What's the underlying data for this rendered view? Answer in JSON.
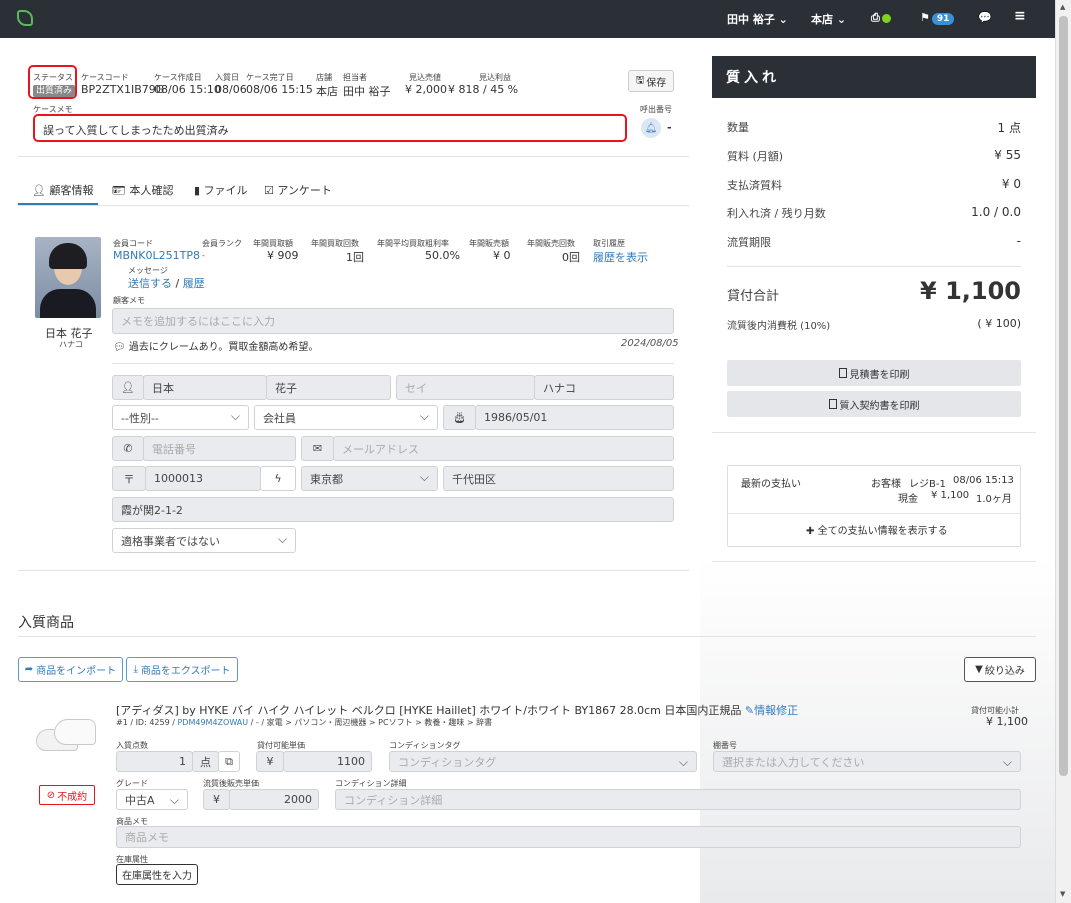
{
  "nav": {
    "user": "田中 裕子 ⌄",
    "store": "本店 ⌄",
    "badge": "91"
  },
  "case": {
    "status_label": "ステータス",
    "status": "出質済み",
    "code_label": "ケースコード",
    "code": "BP2ZTX1IB79G",
    "created_label": "ケース作成日",
    "created": "08/06 15:10",
    "in_label": "入質日",
    "in": "08/06",
    "done_label": "ケース完了日",
    "done": "08/06 15:15",
    "store_label": "店舗",
    "store": "本店",
    "staff_label": "担当者",
    "staff": "田中 裕子",
    "est_sales_label": "見込売値",
    "est_sales": "¥ 2,000",
    "est_profit_label": "見込利益",
    "est_profit": "¥ 818 / 45 %",
    "save": "保存",
    "memo_label": "ケースメモ",
    "memo": "誤って入質してしまったため出質済み",
    "call_label": "呼出番号",
    "call_value": "-"
  },
  "tabs": [
    "顧客情報",
    "本人確認",
    "ファイル",
    "アンケート"
  ],
  "customer": {
    "name": "日本 花子",
    "kana": "ハナコ",
    "code_label": "会員コード",
    "code": "MBNK0L251TP8",
    "rank_label": "会員ランク",
    "rank": "-",
    "buy_amount_label": "年間買取額",
    "buy_amount": "¥ 909",
    "buy_count_label": "年間買取回数",
    "buy_count": "1回",
    "margin_label": "年間平均買取粗利率",
    "margin": "50.0%",
    "sales_label": "年間販売額",
    "sales": "¥ 0",
    "sales_count_label": "年間販売回数",
    "sales_count": "0回",
    "history_label": "取引履歴",
    "history_link": "履歴を表示",
    "message_label": "メッセージ",
    "send_link": "送信する",
    "slash": "/",
    "history2_link": "履歴",
    "memo_label": "顧客メモ",
    "memo_placeholder": "メモを追加するにはここに入力",
    "note": "過去にクレームあり。買取金額高め希望。",
    "note_date": "2024/08/05",
    "last_name": "日本",
    "first_name": "花子",
    "sei_placeholder": "セイ",
    "mei": "ハナコ",
    "gender": "--性別--",
    "job": "会社員",
    "birthday": "1986/05/01",
    "phone_placeholder": "電話番号",
    "email_placeholder": "メールアドレス",
    "zip_icon": "〒",
    "zip": "1000013",
    "pref": "東京都",
    "city": "千代田区",
    "address": "霞が関2-1-2",
    "eligibility": "適格事業者ではない"
  },
  "summary": {
    "title": "質入れ",
    "count_label": "数量",
    "count": "1 点",
    "fee_label": "質料 (月額)",
    "fee": "¥ 55",
    "paid_label": "支払済質料",
    "paid": "¥ 0",
    "interest_label": "利入れ済 / 残り月数",
    "interest": "1.0 / 0.0",
    "expire_label": "流質期限",
    "expire": "-",
    "total_label": "貸付合計",
    "total": "¥ 1,100",
    "tax_label": "流質後内消費税 (10%)",
    "tax": "( ¥ 100)",
    "estimate_btn": "見積書を印刷",
    "contract_btn": "質入契約書を印刷"
  },
  "payment": {
    "latest_label": "最新の支払い",
    "customer": "お客様",
    "register": "レジB-1",
    "time": "08/06 15:13",
    "method": "現金",
    "amount": "¥ 1,100",
    "months": "1.0ヶ月",
    "show_all": "全ての支払い情報を表示する"
  },
  "items_section": {
    "title": "入質商品",
    "import_btn": "商品をインポート",
    "export_btn": "商品をエクスポート",
    "filter_btn": "絞り込み"
  },
  "item": {
    "title": "[アディダス] by HYKE バイ ハイク ハイレット ベルクロ [HYKE Haillet] ホワイト/ホワイト BY1867 28.0cm 日本国内正規品",
    "edit": "情報修正",
    "meta_prefix": "#1 / ID: 4259 /",
    "meta_code": "PDM49M4ZOWAU",
    "meta_suffix": "/ - / 家電 > パソコン・周辺機器 > PCソフト > 教養・趣味 > 辞書",
    "subtotal_label": "貸付可能小計",
    "subtotal": "¥ 1,100",
    "qty_label": "入質点数",
    "qty": "1",
    "qty_unit": "点",
    "lend_label": "貸付可能単価",
    "yen": "¥",
    "lend": "1100",
    "cond_tag_label": "コンディションタグ",
    "cond_tag_placeholder": "コンディションタグ",
    "shelf_label": "棚番号",
    "shelf_placeholder": "選択または入力してください",
    "failed": "不成約",
    "grade_label": "グレード",
    "grade": "中古A",
    "price_label": "流質後販売単価",
    "price": "2000",
    "cond_detail_label": "コンディション詳細",
    "cond_detail_placeholder": "コンディション詳細",
    "memo_label": "商品メモ",
    "memo_placeholder": "商品メモ",
    "stock_label": "在庫属性",
    "stock_btn": "在庫属性を入力"
  }
}
